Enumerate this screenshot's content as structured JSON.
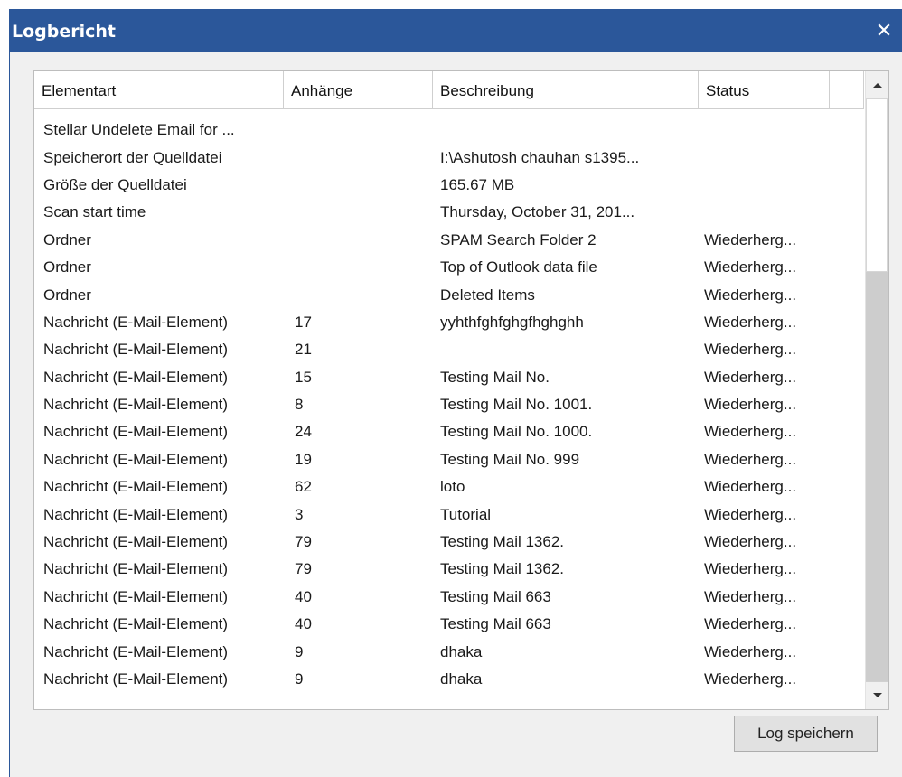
{
  "window": {
    "title": "Logbericht",
    "close_icon": "close-icon"
  },
  "table": {
    "columns": [
      "Elementart",
      "Anhänge",
      "Beschreibung",
      "Status",
      ""
    ],
    "rows": [
      [
        "Stellar Undelete Email for ...",
        "",
        "",
        ""
      ],
      [
        "Speicherort der Quelldatei",
        "",
        "I:\\Ashutosh chauhan s1395...",
        ""
      ],
      [
        "Größe der Quelldatei",
        "",
        "165.67 MB",
        ""
      ],
      [
        "Scan start time",
        "",
        "Thursday, October 31, 201...",
        ""
      ],
      [
        "Ordner",
        "",
        "SPAM Search Folder 2",
        "Wiederherg..."
      ],
      [
        "Ordner",
        "",
        "Top of Outlook data file",
        "Wiederherg..."
      ],
      [
        "Ordner",
        "",
        "Deleted Items",
        "Wiederherg..."
      ],
      [
        "Nachricht (E-Mail-Element)",
        "17",
        "yyhthfghfghgfhghghh",
        "Wiederherg..."
      ],
      [
        "Nachricht (E-Mail-Element)",
        "21",
        "",
        "Wiederherg..."
      ],
      [
        "Nachricht (E-Mail-Element)",
        "15",
        "Testing Mail No.",
        "Wiederherg..."
      ],
      [
        "Nachricht (E-Mail-Element)",
        "8",
        "Testing Mail No. 1001.",
        "Wiederherg..."
      ],
      [
        "Nachricht (E-Mail-Element)",
        "24",
        "Testing Mail No. 1000.",
        "Wiederherg..."
      ],
      [
        "Nachricht (E-Mail-Element)",
        "19",
        "Testing Mail No. 999",
        "Wiederherg..."
      ],
      [
        "Nachricht (E-Mail-Element)",
        "62",
        "loto",
        "Wiederherg..."
      ],
      [
        "Nachricht (E-Mail-Element)",
        "3",
        "Tutorial",
        "Wiederherg..."
      ],
      [
        "Nachricht (E-Mail-Element)",
        "79",
        "Testing Mail 1362.",
        "Wiederherg..."
      ],
      [
        "Nachricht (E-Mail-Element)",
        "79",
        "Testing Mail 1362.",
        "Wiederherg..."
      ],
      [
        "Nachricht (E-Mail-Element)",
        "40",
        "Testing Mail 663",
        "Wiederherg..."
      ],
      [
        "Nachricht (E-Mail-Element)",
        "40",
        "Testing Mail 663",
        "Wiederherg..."
      ],
      [
        "Nachricht (E-Mail-Element)",
        "9",
        "dhaka",
        "Wiederherg..."
      ],
      [
        "Nachricht (E-Mail-Element)",
        "9",
        "dhaka",
        "Wiederherg..."
      ]
    ]
  },
  "scrollbar": {
    "up_icon": "scroll-up-arrow-icon",
    "down_icon": "scroll-down-arrow-icon"
  },
  "buttons": {
    "save_log": "Log speichern"
  },
  "colors": {
    "titlebar": "#2b579a",
    "background": "#f0f0f0",
    "list_background": "#ffffff"
  }
}
